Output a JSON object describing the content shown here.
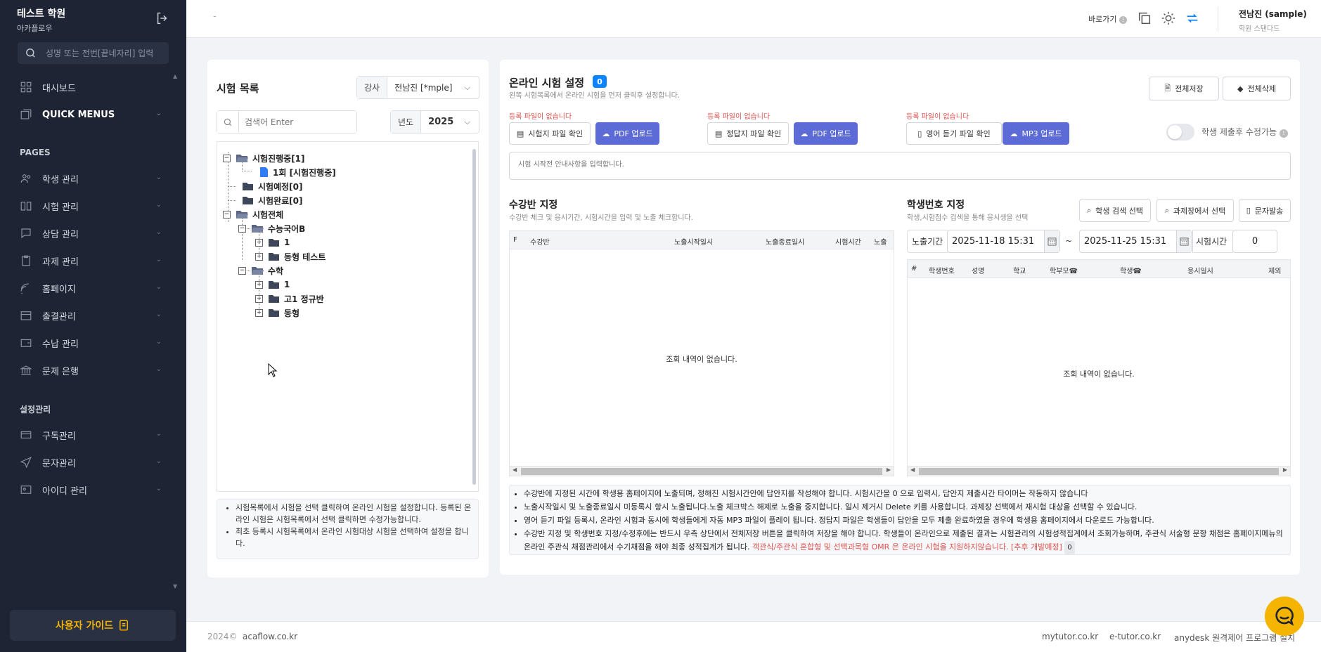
{
  "sidebar": {
    "brand_name": "테스트 학원",
    "brand_sub": "아카플로우",
    "search_placeholder": "성명 또는 전번[끝네자리] 입력",
    "items": [
      {
        "label": "대시보드"
      },
      {
        "label": "QUICK MENUS"
      },
      {
        "label": "학생 관리"
      },
      {
        "label": "시험 관리"
      },
      {
        "label": "상담 관리"
      },
      {
        "label": "과제 관리"
      },
      {
        "label": "홈페이지"
      },
      {
        "label": "출결관리"
      },
      {
        "label": "수납 관리"
      },
      {
        "label": "문제 은행"
      },
      {
        "label": "구독관리"
      },
      {
        "label": "문자관리"
      },
      {
        "label": "아이디 관리"
      }
    ],
    "section_pages": "PAGES",
    "section_settings": "설정관리",
    "guide_label": "사용자 가이드"
  },
  "topbar": {
    "dash": "-",
    "shortcut": "바로가기",
    "user_name": "전남진 (sample)",
    "user_plan": "학원 스탠다드"
  },
  "exam_list": {
    "title": "시험 목록",
    "teacher_label": "강사",
    "teacher_value": "전남진 [*mple]",
    "search_placeholder": "검색어 Enter",
    "year_label": "년도",
    "year_value": "2025",
    "tree": [
      "시험진행중[1]",
      "1회 [시험진행중]",
      "시험예정[0]",
      "시험완료[0]",
      "시험전체",
      "수능국어B",
      "1",
      "동형 테스트",
      "수학",
      "1",
      "고1 정규반",
      "동형"
    ],
    "notes": [
      "시험목록에서 시험을 선택 클릭하여 온라인 시험을 설정합니다. 등록된 온라인 시험은 시험목록에서 선택 클릭하면 수정가능합니다.",
      "최초 등록시 시험목록에서 온라인 시험대상 시험을 선택하여 설정을 합니다."
    ]
  },
  "online": {
    "title": "온라인 시험 설정",
    "badge": "0",
    "subtitle": "왼쪽 시험목록에서 온라인 시험을 먼저 클릭후 설정합니다.",
    "save_all": "전체저장",
    "delete_all": "전체삭제",
    "no_file": "등록 파일이 없습니다",
    "exam_file_check": "시험지 파일 확인",
    "pdf_upload": "PDF 업로드",
    "answer_file_check": "정답지 파일 확인",
    "listening_file_check": "영어 듣기 파일 확인",
    "mp3_upload": "MP3 업로드",
    "toggle_label": "학생 제출후 수정가능",
    "notice_placeholder": "시험 시작전 안내사항을 입력합니다.",
    "class_title": "수강반 지정",
    "class_sub": "수강반 체크 및 응시기간, 시험시간을 입력 및 노출 체크합니다.",
    "class_cols": [
      "F",
      "수강반",
      "노출시작일시",
      "노출종료일시",
      "시험시간",
      "노출"
    ],
    "empty": "조회 내역이 없습니다.",
    "student_title": "학생번호 지정",
    "student_sub": "학생,시험점수 검색을 통해 응시생을 선택",
    "student_search": "학생 검색 선택",
    "assign_select": "과제장에서 선택",
    "sms_send": "문자발송",
    "period_label": "노출기간",
    "start": "2025-11-18 15:31",
    "tilde": "~",
    "end": "2025-11-25 15:31",
    "time_label": "시험시간",
    "time_value": "0",
    "student_cols": [
      "#",
      "학생번호",
      "성명",
      "학교",
      "학부모☎",
      "학생☎",
      "응시일시",
      "제외"
    ],
    "notes": [
      "수강반에 지정된 시간에 학생용 홈페이지에 노출되며, 정해진 시험시간안에 답안지를 작성해야 합니다. 시험시간을 0 으로 입력시, 답안지 제출시간 타이머는 작동하지 않습니다",
      "노출시작일시 및 노출종료일시 미등록시 항시 노출됩니다.노출 체크박스 해제로 노출을 중지합니다. 일시 제거시 Delete 키를 사용합니다. 과제장 선택에서 재시험 대상을 선택할 수 있습니다.",
      "영어 듣기 파일 등록시, 온라인 시험과 동시에 학생들에게 자동 MP3 파일이 플레이 됩니다. 정답지 파일은 학생들이 답안을 모두 제출 완료하였을 경우에 학생용 홈페이지에서 다운로드 가능합니다.",
      "수강반 지정 및 학생번호 지정/수정후에는 반드시 우측 상단에서 전체저장 버튼을 클릭하여 저장을 해야 합니다. 학생들이 온라인으로 제출된 결과는 시험관리의 시험성적집계에서 조회가능하며, 주관식 서술형 문항 채점은 홈페이지메뉴의 온라인 주관식 채점관리에서 수기채점을 해야 최종 성적집계가 됩니다."
    ],
    "notes_red": "객관식/주관식 혼합형 및 선택과목형 OMR 은 온라인 시험을 지원하지않습니다. [추후 개발예정]",
    "notes_badge": "0"
  },
  "footer": {
    "copyright": "2024©",
    "site": "acaflow.co.kr",
    "links": [
      "mytutor.co.kr",
      "e-tutor.co.kr",
      "anydesk 원격제어 프로그램 설치"
    ]
  },
  "colors": {
    "primary": "#5c6bd6",
    "sidebar": "#1e2433",
    "accent": "#f4b400",
    "badge": "#0a84ff"
  }
}
